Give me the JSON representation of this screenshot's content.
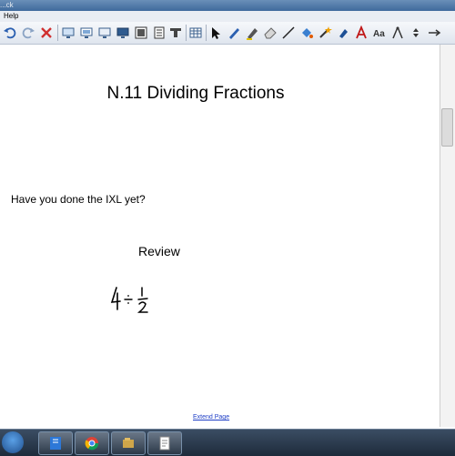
{
  "window": {
    "title": "...ck"
  },
  "menubar": {
    "help_label": "Help"
  },
  "toolbar": {
    "icons": [
      "undo-icon",
      "redo-icon",
      "delete-icon",
      "screen-shade-icon",
      "show-screen-icon",
      "monitor-icon",
      "capture-icon",
      "table-icon",
      "select-icon",
      "pen-icon",
      "highlighter-icon",
      "eraser-icon",
      "line-icon",
      "fill-icon",
      "magic-pen-icon",
      "text-icon",
      "font-icon",
      "measure-icon",
      "more-icon"
    ]
  },
  "page": {
    "title": "N.11 Dividing Fractions",
    "question": "Have you done the IXL yet?",
    "section": "Review",
    "extend_link": "Extend Page"
  },
  "taskbar": {
    "apps": [
      "notebook-app",
      "chrome-app",
      "files-app",
      "notes-app"
    ]
  },
  "colors": {
    "link": "#1f3fc6",
    "taskbar": "#2a3a4e"
  }
}
